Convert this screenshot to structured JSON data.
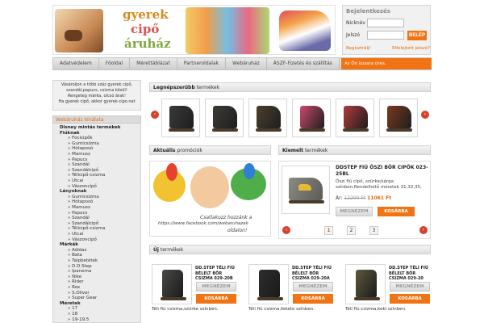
{
  "header": {
    "logo_lines": [
      "gyerek",
      "cipő",
      "áruház"
    ]
  },
  "login": {
    "title": "Bejelentkezés",
    "nick_label": "Nicknév",
    "password_label": "Jelszó",
    "submit": "BELÉP",
    "register": "Regisztrálj!",
    "forgot": "Elfelejtett jelszó?"
  },
  "nav": {
    "items": [
      "Adatvédelem",
      "Főoldal",
      "Mérettáblázat",
      "Partneroldalak",
      "Webáruház",
      "ÁSZF-Fizetés és szállítás"
    ],
    "cart": "Az Ön kosara üres."
  },
  "sidebar": {
    "promo_lines": [
      "Vásároljon a több száz gyerek cipő,",
      "szandál,papucs, csizma közül!",
      "Rengeteg márka, olcsó árak!",
      "Ha gyerek cipő, akkor gyerek-cipo.net"
    ],
    "category_title": "Webáruház kínálata",
    "categories": [
      {
        "label": "Disney mintás termékek",
        "bold": true
      },
      {
        "label": "Fiúknak",
        "bold": true
      },
      {
        "label": "» Focicipők",
        "bold": false
      },
      {
        "label": "» Gumicsizma",
        "bold": false
      },
      {
        "label": "» Hótaposó",
        "bold": false
      },
      {
        "label": "» Mamusz",
        "bold": false
      },
      {
        "label": "» Papucs",
        "bold": false
      },
      {
        "label": "» Szandál",
        "bold": false
      },
      {
        "label": "» Szandálcipő",
        "bold": false
      },
      {
        "label": "» Télicipő-csizma",
        "bold": false
      },
      {
        "label": "» Utcai",
        "bold": false
      },
      {
        "label": "» Vászoncipő",
        "bold": false
      },
      {
        "label": "Lányoknak",
        "bold": true
      },
      {
        "label": "» Gumicsizma",
        "bold": false
      },
      {
        "label": "» Hótaposó",
        "bold": false
      },
      {
        "label": "» Mamusz",
        "bold": false
      },
      {
        "label": "» Papucs",
        "bold": false
      },
      {
        "label": "» Szandál",
        "bold": false
      },
      {
        "label": "» Szandálcipő",
        "bold": false
      },
      {
        "label": "» Télicipő-csizma",
        "bold": false
      },
      {
        "label": "» Utcai",
        "bold": false
      },
      {
        "label": "» Vászoncipő",
        "bold": false
      },
      {
        "label": "Márkák",
        "bold": true
      },
      {
        "label": "» Adidas",
        "bold": false
      },
      {
        "label": "» Bata",
        "bold": false
      },
      {
        "label": "» Talpbetétek",
        "bold": false
      },
      {
        "label": "» D.D.Step",
        "bold": false
      },
      {
        "label": "» Ipanema",
        "bold": false
      },
      {
        "label": "» Nike",
        "bold": false
      },
      {
        "label": "» Rider",
        "bold": false
      },
      {
        "label": "» Rox",
        "bold": false
      },
      {
        "label": "» S.Oliver",
        "bold": false
      },
      {
        "label": "» Super Gear",
        "bold": false
      },
      {
        "label": "Méretek",
        "bold": true
      },
      {
        "label": "» 17",
        "bold": false
      },
      {
        "label": "» 18",
        "bold": false
      },
      {
        "label": "» 19-19.5",
        "bold": false
      }
    ]
  },
  "popular": {
    "title_bold": "Legnépszerűbb",
    "title_rest": " termékek",
    "prev": "‹",
    "next": "›",
    "colors": [
      "#3a3a3a",
      "#3e3b36",
      "#4b3f2e",
      "#c94a6e",
      "#b03a3a",
      "#7a3a1e"
    ]
  },
  "promotions": {
    "title_bold": "Aktuális",
    "title_rest": " promóciók",
    "image_text_1": "Csatlakozz hozzánk a",
    "image_text_2": "https://www.facebook.com/webaruhazak",
    "image_text_3": "oldalon!"
  },
  "featured": {
    "title_bold": "Kiemelt",
    "title_rest": " termékek",
    "product_name": "DDSTEP FIÚ ŐSZI BŐR CIPŐK 023-25BL",
    "description": "Őszi fiú cipő, szürke/sárga színben.Rendelhető méretek 31,32,35,",
    "price_label": "Ár:",
    "old_price": "12290 Ft",
    "new_price": "11061 Ft",
    "view": "MEGNÉZEM",
    "cart": "KOSÁRBA",
    "pages": [
      "1",
      "2",
      "3"
    ]
  },
  "new_products": {
    "title_bold": "Új",
    "title_rest": " termékek",
    "items": [
      {
        "title": "DD.STEP TÉLI FIÚ BÉLELT BŐR CSIZMA 029-20B",
        "desc": "Téli fiú csizma,szürke színben.",
        "view": "MEGNÉZEM",
        "cart": "KOSÁRBA",
        "color": "#4a4a48"
      },
      {
        "title": "DD.STEP TÉLI FIÚ BÉLELT BŐR CSIZMA 029-20A",
        "desc": "Téli fiú csizma,fekete színben.",
        "view": "MEGNÉZEM",
        "cart": "KOSÁRBA",
        "color": "#2e2e2e"
      },
      {
        "title": "DD.STEP TÉLI FIÚ BÉLELT BŐR CSIZMA 029-20",
        "desc": "Téli fiú csizma,keki színben.",
        "view": "MEGNÉZEM",
        "cart": "KOSÁRBA",
        "color": "#5e5a3e"
      }
    ]
  },
  "colors": {
    "accent": "#f07414",
    "arrow": "#d7402b",
    "price": "#e06a10"
  }
}
